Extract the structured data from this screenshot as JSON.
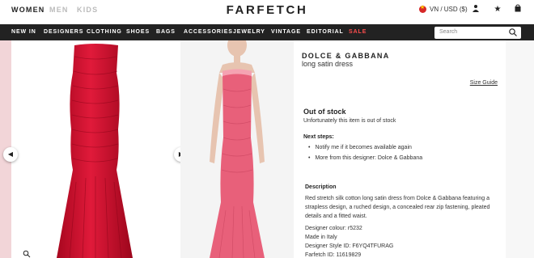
{
  "header": {
    "genders": [
      "WOMEN",
      "MEN",
      "KIDS"
    ],
    "logo": "FARFETCH",
    "region": "VN / USD ($)",
    "icons": [
      "account-icon",
      "wishlist-star-icon",
      "bag-icon"
    ]
  },
  "nav": {
    "items": [
      "NEW IN",
      "DESIGNERS",
      "CLOTHING",
      "SHOES",
      "BAGS",
      "ACCESSORIES",
      "JEWELRY",
      "VINTAGE",
      "EDITORIAL",
      "SALE"
    ],
    "search_placeholder": "Search"
  },
  "colors": {
    "nav_bg": "#222222",
    "sale": "#ff4d4d",
    "dress_red": "#d0142f",
    "dress_pink": "#e8607a"
  },
  "product": {
    "brand": "DOLCE & GABBANA",
    "name": "long satin dress",
    "size_guide": "Size Guide",
    "stock_title": "Out of stock",
    "stock_message": "Unfortunately this item is out of stock",
    "next_steps_title": "Next steps:",
    "next_steps": [
      "Notify me if it becomes available again",
      "More from this designer: Dolce & Gabbana"
    ],
    "description_title": "Description",
    "description": "Red stretch silk cotton long satin dress from Dolce & Gabbana featuring a strapless design, a ruched design, a concealed rear zip fastening, pleated details and a fitted waist.",
    "designer_colour": "Designer colour: r5232",
    "made_in": "Made in Italy",
    "style_id": "Designer Style ID: F6YQ4TFURAG",
    "farfetch_id": "Farfetch ID: 11619829"
  },
  "gallery": {
    "prev_icon": "chevron-left-icon",
    "next_icon": "chevron-right-icon",
    "zoom_icon": "zoom-icon"
  }
}
